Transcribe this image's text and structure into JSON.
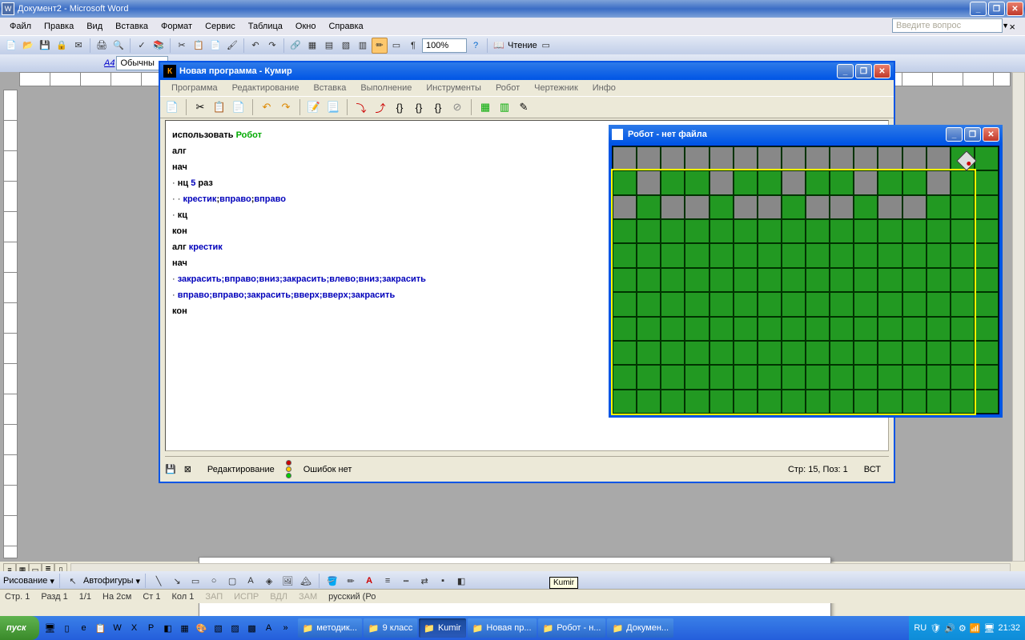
{
  "word": {
    "title": "Документ2 - Microsoft Word",
    "menu": [
      "Файл",
      "Правка",
      "Вид",
      "Вставка",
      "Формат",
      "Сервис",
      "Таблица",
      "Окно",
      "Справка"
    ],
    "question_placeholder": "Введите вопрос",
    "zoom": "100%",
    "reading": "Чтение",
    "style1": "Обычны",
    "draw_label": "Рисование",
    "autoshapes": "Автофигуры",
    "status": {
      "page": "Стр. 1",
      "section": "Разд 1",
      "pages": "1/1",
      "at": "На 2см",
      "line": "Ст 1",
      "col": "Кол 1",
      "dim": [
        "ЗАП",
        "ИСПР",
        "ВДЛ",
        "ЗАМ"
      ],
      "lang": "русский (Ро"
    },
    "tooltip": "Kumir"
  },
  "kumir": {
    "title": "Новая программа - Кумир",
    "menu": [
      "Программа",
      "Редактирование",
      "Вставка",
      "Выполнение",
      "Инструменты",
      "Робот",
      "Чертежник",
      "Инфо"
    ],
    "code": {
      "l1a": "использовать ",
      "l1b": "Робот",
      "l2": "алг",
      "l3": "нач",
      "l4a": "нц ",
      "l4b": "5",
      "l4c": " раз",
      "l5": "крестик",
      "l5b": ";",
      "l5c": "вправо",
      "l5d": ";",
      "l5e": "вправо",
      "l6": "кц",
      "l7": "кон",
      "l8a": "алг ",
      "l8b": "крестик",
      "l9": "нач",
      "l10": "закрасить;вправо;вниз;закрасить;влево;вниз;закрасить",
      "l11": "вправо;вправо;закрасить;вверх;вверх;закрасить",
      "l12": "кон"
    },
    "status": {
      "mode": "Редактирование",
      "errors": "Ошибок нет",
      "pos": "Стр: 15, Поз: 1",
      "ins": "ВСТ"
    }
  },
  "robot": {
    "title": "Робот - нет файла",
    "dark_cells": [
      [
        0,
        0
      ],
      [
        0,
        1
      ],
      [
        0,
        2
      ],
      [
        0,
        3
      ],
      [
        0,
        4
      ],
      [
        0,
        5
      ],
      [
        0,
        6
      ],
      [
        0,
        7
      ],
      [
        0,
        8
      ],
      [
        0,
        9
      ],
      [
        0,
        10
      ],
      [
        0,
        11
      ],
      [
        0,
        12
      ],
      [
        0,
        13
      ],
      [
        1,
        1
      ],
      [
        1,
        4
      ],
      [
        1,
        7
      ],
      [
        1,
        10
      ],
      [
        1,
        13
      ],
      [
        2,
        0
      ],
      [
        2,
        2
      ],
      [
        2,
        3
      ],
      [
        2,
        5
      ],
      [
        2,
        6
      ],
      [
        2,
        8
      ],
      [
        2,
        9
      ],
      [
        2,
        11
      ],
      [
        2,
        12
      ]
    ],
    "robot_pos": {
      "row": 0,
      "col": 14
    }
  },
  "taskbar": {
    "start": "пуск",
    "tasks": [
      {
        "label": "методик...",
        "active": false
      },
      {
        "label": "9 класс",
        "active": false
      },
      {
        "label": "Kumir",
        "active": true
      },
      {
        "label": "Новая пр...",
        "active": false
      },
      {
        "label": "Робот - н...",
        "active": false
      },
      {
        "label": "Докумен...",
        "active": false
      }
    ],
    "lang": "RU",
    "time": "21:32"
  }
}
